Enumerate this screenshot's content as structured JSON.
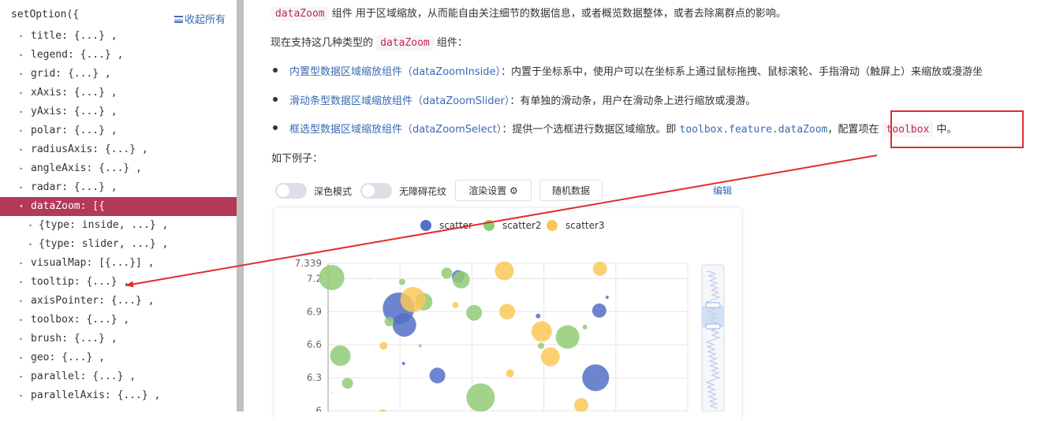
{
  "sidebar": {
    "root_label": "setOption({",
    "collapse_all_label": "收起所有",
    "items": [
      {
        "label": "title: {...} ,",
        "caret": "▸",
        "indent": 0
      },
      {
        "label": "legend: {...} ,",
        "caret": "▸",
        "indent": 0
      },
      {
        "label": "grid: {...} ,",
        "caret": "▸",
        "indent": 0
      },
      {
        "label": "xAxis: {...} ,",
        "caret": "▸",
        "indent": 0
      },
      {
        "label": "yAxis: {...} ,",
        "caret": "▸",
        "indent": 0
      },
      {
        "label": "polar: {...} ,",
        "caret": "▸",
        "indent": 0
      },
      {
        "label": "radiusAxis: {...} ,",
        "caret": "▸",
        "indent": 0
      },
      {
        "label": "angleAxis: {...} ,",
        "caret": "▸",
        "indent": 0
      },
      {
        "label": "radar: {...} ,",
        "caret": "▸",
        "indent": 0
      },
      {
        "label": "dataZoom: [{",
        "caret": "▾",
        "indent": 0,
        "active": true
      },
      {
        "label": "{type: inside, ...} ,",
        "caret": "▸",
        "indent": 1
      },
      {
        "label": "{type: slider, ...} ,",
        "caret": "▸",
        "indent": 1
      },
      {
        "label": "visualMap: [{...}] ,",
        "caret": "▸",
        "indent": 0
      },
      {
        "label": "tooltip: {...} ,",
        "caret": "▸",
        "indent": 0
      },
      {
        "label": "axisPointer: {...} ,",
        "caret": "▸",
        "indent": 0
      },
      {
        "label": "toolbox: {...} ,",
        "caret": "▸",
        "indent": 0
      },
      {
        "label": "brush: {...} ,",
        "caret": "▸",
        "indent": 0
      },
      {
        "label": "geo: {...} ,",
        "caret": "▸",
        "indent": 0
      },
      {
        "label": "parallel: {...} ,",
        "caret": "▸",
        "indent": 0
      },
      {
        "label": "parallelAxis: {...} ,",
        "caret": "▸",
        "indent": 0
      }
    ]
  },
  "doc": {
    "intro_code": "dataZoom",
    "intro_text": " 组件 用于区域缩放，从而能自由关注细节的数据信息，或者概览数据整体，或者去除离群点的影响。",
    "types_prefix": "现在支持这几种类型的 ",
    "types_code": "dataZoom",
    "types_suffix": " 组件：",
    "bullet1_link": "内置型数据区域缩放组件（dataZoomInside）",
    "bullet1_text": "：内置于坐标系中，使用户可以在坐标系上通过鼠标拖拽、鼠标滚轮、手指滑动（触屏上）来缩放或漫游坐",
    "bullet2_link": "滑动条型数据区域缩放组件（dataZoomSlider）",
    "bullet2_text": "：有单独的滑动条，用户在滑动条上进行缩放或漫游。",
    "bullet3_link": "框选型数据区域缩放组件（dataZoomSelect）",
    "bullet3_text": "：提供一个选框进行数据区域缩放。即 ",
    "bullet3_code": "toolbox.feature.dataZoom",
    "bullet3_mid": "，配置项在 ",
    "bullet3_code2": "toolbox",
    "bullet3_end": " 中。",
    "example_label": "如下例子："
  },
  "toolbar": {
    "dark_mode_label": "深色模式",
    "accessible_label": "无障碍花纹",
    "render_settings_label": "渲染设置 ⚙",
    "random_data_label": "随机数据",
    "edit_label": "编辑"
  },
  "colors": {
    "active_bg": "#b2395a",
    "highlight_border": "#e02d2d",
    "series_blue": "#5470c6",
    "series_green": "#91cc75",
    "series_yellow": "#fac858"
  },
  "chart_data": {
    "type": "scatter",
    "legend": [
      "scatter",
      "scatter2",
      "scatter3"
    ],
    "y_ticks": [
      "7.339",
      "7.2",
      "6.9",
      "6.6",
      "6.3",
      "6"
    ],
    "ylim": [
      6,
      7.339
    ],
    "xlim": [
      0,
      5
    ],
    "series": [
      {
        "name": "scatter",
        "color": "#5470c6",
        "points": [
          [
            0.98,
            6.93,
            20
          ],
          [
            1.06,
            6.78,
            15
          ],
          [
            1.52,
            6.32,
            10
          ],
          [
            1.81,
            7.22,
            8
          ],
          [
            3.72,
            6.3,
            17
          ],
          [
            3.77,
            6.91,
            9
          ],
          [
            1.05,
            6.43,
            2
          ],
          [
            2.92,
            6.86,
            3
          ],
          [
            3.88,
            7.03,
            2
          ]
        ]
      },
      {
        "name": "scatter2",
        "color": "#91cc75",
        "points": [
          [
            0.05,
            7.21,
            16
          ],
          [
            0.17,
            6.5,
            13
          ],
          [
            0.27,
            6.25,
            7
          ],
          [
            0.85,
            6.81,
            6
          ],
          [
            1.03,
            7.17,
            4
          ],
          [
            1.33,
            6.99,
            11
          ],
          [
            1.65,
            7.25,
            7
          ],
          [
            1.85,
            7.19,
            11
          ],
          [
            2.03,
            6.89,
            10
          ],
          [
            2.12,
            6.12,
            18
          ],
          [
            3.33,
            6.67,
            15
          ],
          [
            3.57,
            6.76,
            3
          ],
          [
            2.96,
            6.59,
            4
          ],
          [
            1.28,
            6.59,
            2
          ],
          [
            3.05,
            6.73,
            2
          ]
        ]
      },
      {
        "name": "scatter3",
        "color": "#fac858",
        "points": [
          [
            1.18,
            7.01,
            16
          ],
          [
            1.77,
            6.96,
            4
          ],
          [
            2.45,
            7.27,
            12
          ],
          [
            2.49,
            6.9,
            10
          ],
          [
            2.53,
            6.34,
            5
          ],
          [
            2.97,
            6.72,
            13
          ],
          [
            3.52,
            6.05,
            9
          ],
          [
            3.09,
            6.49,
            12
          ],
          [
            3.78,
            7.29,
            9
          ],
          [
            0.76,
            5.97,
            6
          ],
          [
            0.77,
            6.59,
            5
          ],
          [
            0.58,
            7.2,
            1
          ],
          [
            0.06,
            6.16,
            1
          ]
        ]
      }
    ]
  }
}
